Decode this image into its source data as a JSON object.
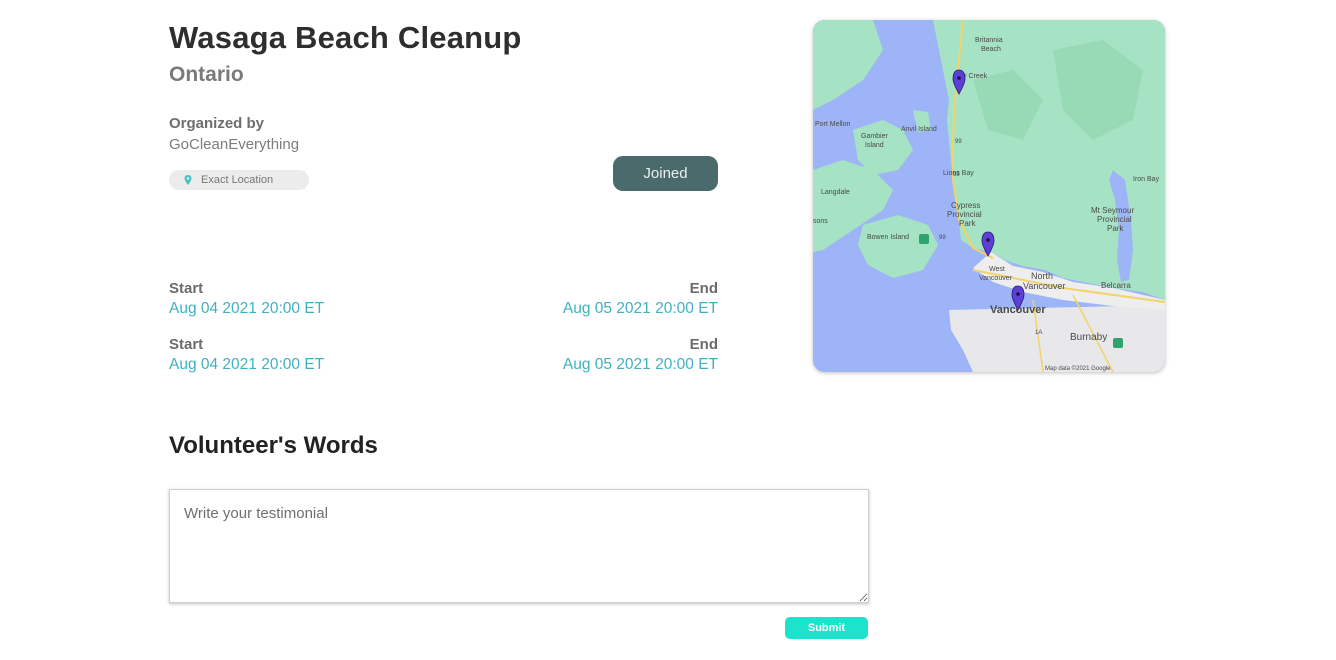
{
  "event": {
    "title": "Wasaga Beach Cleanup",
    "region": "Ontario",
    "organized_by_label": "Organized by",
    "organizer": "GoCleanEverything",
    "location_chip": "Exact Location",
    "status_button": "Joined"
  },
  "schedule": [
    {
      "start_label": "Start",
      "start": "Aug 04 2021 20:00 ET",
      "end_label": "End",
      "end": "Aug 05 2021 20:00 ET"
    },
    {
      "start_label": "Start",
      "start": "Aug 04 2021 20:00 ET",
      "end_label": "End",
      "end": "Aug 05 2021 20:00 ET"
    }
  ],
  "map": {
    "labels": {
      "britannia": "Britannia",
      "beach": "Beach",
      "creek": "y Creek",
      "port_mellon": "Port Mellon",
      "gambier": "Gambier",
      "island": "Island",
      "anvil": "Anvil Island",
      "lions_bay": "Lions Bay",
      "iron_bay": "Iron Bay",
      "cypress": "Cypress",
      "provincial": "Provincial",
      "park": "Park",
      "mt_seymour": "Mt Seymour",
      "langdale": "Langdale",
      "bowen": "Bowen Island",
      "sons": "sons",
      "west": "West",
      "vancouver_small": "Vancouver",
      "north": "North",
      "north_vancouver": "Vancouver",
      "belcarra": "Belcarra",
      "vancouver": "Vancouver",
      "burnaby": "Burnaby",
      "attribution": "Map data ©2021 Google",
      "hwy99_a": "99",
      "hwy99_b": "99",
      "hwy99_c": "99",
      "hwy1a": "1A"
    },
    "colors": {
      "water": "#9db4f7",
      "land": "#a6e3c4",
      "pin": "#5b3fd6"
    }
  },
  "testimonial": {
    "heading": "Volunteer's Words",
    "placeholder": "Write your testimonial",
    "value": "",
    "submit_label": "Submit"
  }
}
